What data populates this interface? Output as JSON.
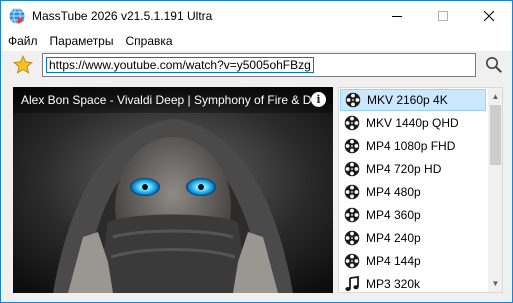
{
  "window": {
    "title": "MassTube 2026 v21.5.1.191 Ultra",
    "accent_color": "#1883d7"
  },
  "menu": {
    "items": [
      "Файл",
      "Параметры",
      "Справка"
    ]
  },
  "toolbar": {
    "url": "https://www.youtube.com/watch?v=y5005ohFBzg",
    "favorite_icon": "star-icon",
    "search_icon": "magnifier-icon"
  },
  "preview": {
    "title": "Alex Bon Space - Vivaldi Deep | Symphony of Fire & Darkness",
    "info_glyph": "i"
  },
  "formats": {
    "selected_color": "#cce8ff",
    "items": [
      {
        "label": "MKV 2160p 4K",
        "icon": "film-reel-icon",
        "selected": true
      },
      {
        "label": "MKV 1440p QHD",
        "icon": "film-reel-icon",
        "selected": false
      },
      {
        "label": "MP4 1080p FHD",
        "icon": "film-reel-icon",
        "selected": false
      },
      {
        "label": "MP4 720p HD",
        "icon": "film-reel-icon",
        "selected": false
      },
      {
        "label": "MP4 480p",
        "icon": "film-reel-icon",
        "selected": false
      },
      {
        "label": "MP4 360p",
        "icon": "film-reel-icon",
        "selected": false
      },
      {
        "label": "MP4 240p",
        "icon": "film-reel-icon",
        "selected": false
      },
      {
        "label": "MP4 144p",
        "icon": "film-reel-icon",
        "selected": false
      },
      {
        "label": "MP3 320k",
        "icon": "music-note-icon",
        "selected": false
      }
    ]
  }
}
